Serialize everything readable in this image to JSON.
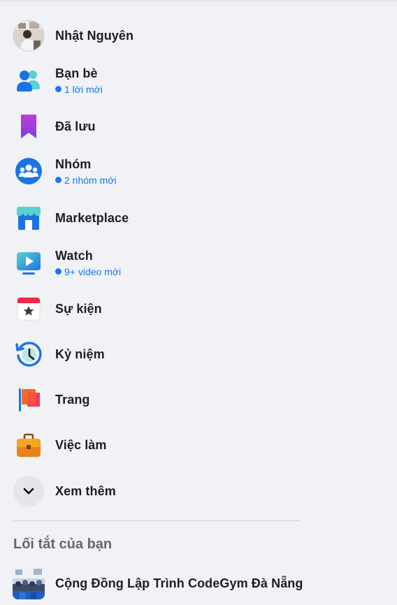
{
  "profile": {
    "name": "Nhật Nguyên"
  },
  "menu": [
    {
      "label": "Bạn bè",
      "sub": "1 lời mời",
      "icon": "friends-icon"
    },
    {
      "label": "Đã lưu",
      "icon": "saved-bookmark-icon"
    },
    {
      "label": "Nhóm",
      "sub": "2 nhóm mới",
      "icon": "groups-icon"
    },
    {
      "label": "Marketplace",
      "icon": "marketplace-store-icon"
    },
    {
      "label": "Watch",
      "sub": "9+ video mới",
      "icon": "watch-play-icon"
    },
    {
      "label": "Sự kiện",
      "icon": "events-calendar-icon"
    },
    {
      "label": "Kỷ niệm",
      "icon": "memories-clock-icon"
    },
    {
      "label": "Trang",
      "icon": "pages-flag-icon"
    },
    {
      "label": "Việc làm",
      "icon": "jobs-briefcase-icon"
    }
  ],
  "see_more": {
    "label": "Xem thêm",
    "icon": "chevron-down-icon"
  },
  "shortcuts": {
    "title": "Lối tắt của bạn",
    "items": [
      {
        "label": "Cộng Đồng Lập Trình CodeGym Đà Nẵng"
      }
    ]
  },
  "colors": {
    "background": "#f0f2f5",
    "accent": "#1877f2",
    "secondary_text": "#65676b"
  }
}
